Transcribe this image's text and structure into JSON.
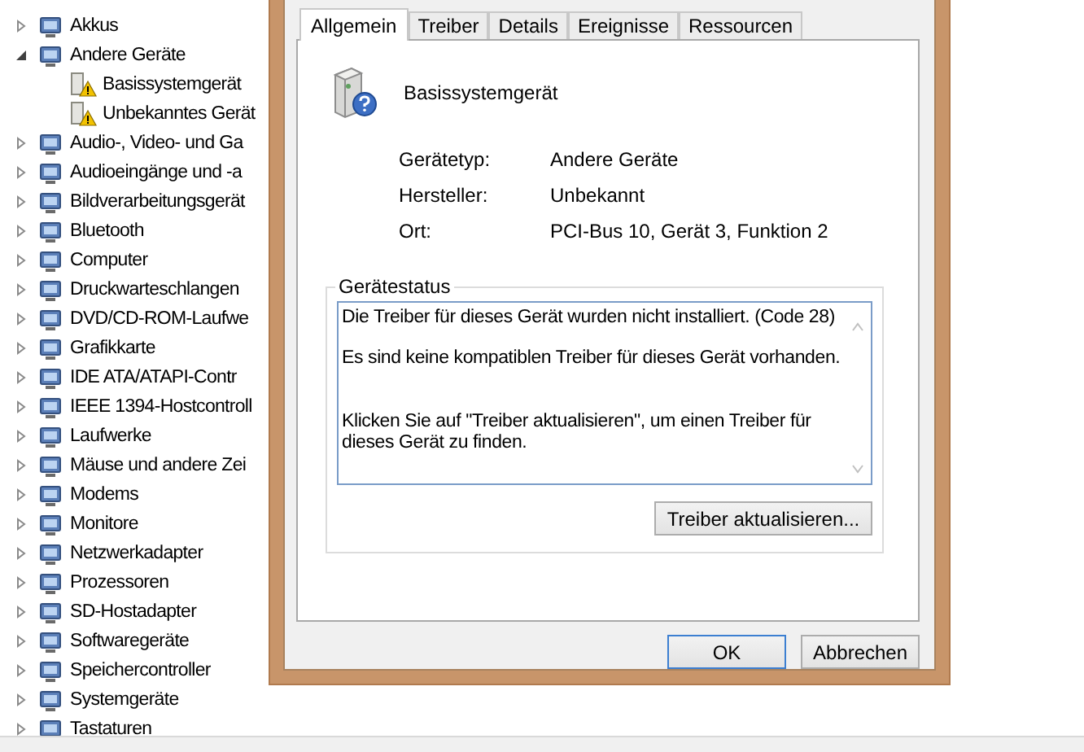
{
  "device_tree": [
    {
      "label": "Akkus",
      "expanded": false
    },
    {
      "label": "Andere Geräte",
      "expanded": true,
      "children": [
        {
          "label": "Basissystemgerät",
          "warning": true
        },
        {
          "label": "Unbekanntes Gerät",
          "warning": true
        }
      ]
    },
    {
      "label": "Audio-, Video- und Ga",
      "expanded": false
    },
    {
      "label": "Audioeingänge und -a",
      "expanded": false
    },
    {
      "label": "Bildverarbeitungsgerät",
      "expanded": false
    },
    {
      "label": "Bluetooth",
      "expanded": false
    },
    {
      "label": "Computer",
      "expanded": false
    },
    {
      "label": "Druckwarteschlangen",
      "expanded": false
    },
    {
      "label": "DVD/CD-ROM-Laufwe",
      "expanded": false
    },
    {
      "label": "Grafikkarte",
      "expanded": false
    },
    {
      "label": "IDE ATA/ATAPI-Contr",
      "expanded": false
    },
    {
      "label": "IEEE 1394-Hostcontroll",
      "expanded": false
    },
    {
      "label": "Laufwerke",
      "expanded": false
    },
    {
      "label": "Mäuse und andere Zei",
      "expanded": false
    },
    {
      "label": "Modems",
      "expanded": false
    },
    {
      "label": "Monitore",
      "expanded": false
    },
    {
      "label": "Netzwerkadapter",
      "expanded": false
    },
    {
      "label": "Prozessoren",
      "expanded": false
    },
    {
      "label": "SD-Hostadapter",
      "expanded": false
    },
    {
      "label": "Softwaregeräte",
      "expanded": false
    },
    {
      "label": "Speichercontroller",
      "expanded": false
    },
    {
      "label": "Systemgeräte",
      "expanded": false
    },
    {
      "label": "Tastaturen",
      "expanded": false
    }
  ],
  "dialog": {
    "tabs": [
      {
        "label": "Allgemein",
        "selected": true
      },
      {
        "label": "Treiber",
        "selected": false
      },
      {
        "label": "Details",
        "selected": false
      },
      {
        "label": "Ereignisse",
        "selected": false
      },
      {
        "label": "Ressourcen",
        "selected": false
      }
    ],
    "device_name": "Basissystemgerät",
    "properties": [
      {
        "label": "Gerätetyp:",
        "value": "Andere Geräte"
      },
      {
        "label": "Hersteller:",
        "value": "Unbekannt"
      },
      {
        "label": "Ort:",
        "value": "PCI-Bus 10, Gerät 3, Funktion 2"
      }
    ],
    "status_group": {
      "title": "Gerätestatus",
      "paragraphs": [
        "Die Treiber für dieses Gerät wurden nicht installiert. (Code 28)",
        "Es sind keine kompatiblen Treiber für dieses Gerät vorhanden.",
        "Klicken Sie auf \"Treiber aktualisieren\", um einen Treiber für dieses Gerät zu finden."
      ],
      "button": "Treiber aktualisieren..."
    },
    "buttons": [
      {
        "label": "OK",
        "default": true
      },
      {
        "label": "Abbrechen",
        "default": false
      }
    ]
  }
}
